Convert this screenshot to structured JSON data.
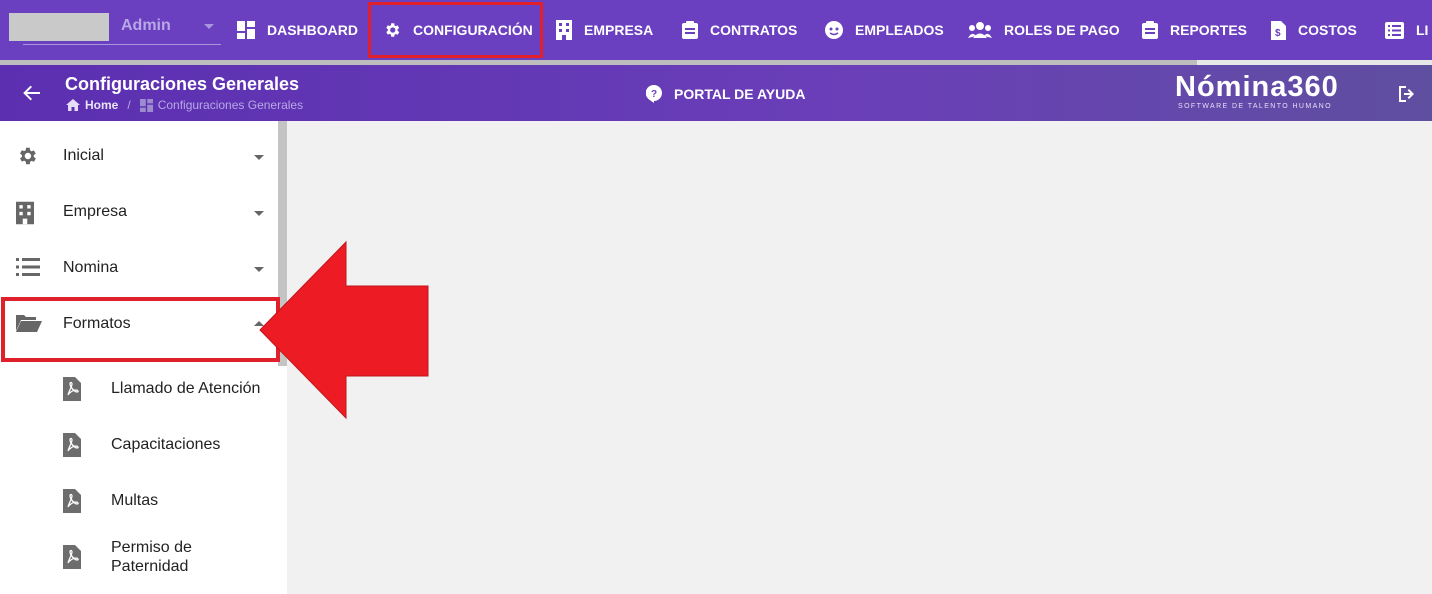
{
  "topnav": {
    "user_name": "Admin",
    "items": [
      {
        "label": "DASHBOARD",
        "icon": "dashboard-icon"
      },
      {
        "label": "CONFIGURACIÓN",
        "icon": "gear-icon"
      },
      {
        "label": "EMPRESA",
        "icon": "building-icon"
      },
      {
        "label": "CONTRATOS",
        "icon": "clipboard-icon"
      },
      {
        "label": "EMPLEADOS",
        "icon": "face-icon"
      },
      {
        "label": "ROLES DE PAGO",
        "icon": "group-icon"
      },
      {
        "label": "REPORTES",
        "icon": "clipboard-icon"
      },
      {
        "label": "COSTOS",
        "icon": "dollar-file-icon"
      },
      {
        "label": "LI",
        "icon": "list-icon"
      }
    ]
  },
  "subheader": {
    "title": "Configuraciones Generales",
    "breadcrumb_home": "Home",
    "breadcrumb_sep": "/",
    "breadcrumb_current": "Configuraciones Generales",
    "help_label": "PORTAL DE AYUDA",
    "logo_text": "Nómina360",
    "logo_subtitle": "SOFTWARE DE TALENTO HUMANO"
  },
  "sidebar": {
    "items": [
      {
        "label": "Inicial",
        "icon": "gear-icon",
        "expanded": false
      },
      {
        "label": "Empresa",
        "icon": "building-icon",
        "expanded": false
      },
      {
        "label": "Nomina",
        "icon": "list-icon",
        "expanded": false
      },
      {
        "label": "Formatos",
        "icon": "folder-open-icon",
        "expanded": true
      }
    ],
    "sub_items": [
      {
        "label": "Llamado de Atención",
        "icon": "pdf-file-icon"
      },
      {
        "label": "Capacitaciones",
        "icon": "pdf-file-icon"
      },
      {
        "label": "Multas",
        "icon": "pdf-file-icon"
      },
      {
        "label": "Permiso de Paternidad",
        "icon": "pdf-file-icon"
      }
    ]
  },
  "colors": {
    "brand_purple": "#6a3fc0",
    "highlight_red": "#e0202a"
  }
}
